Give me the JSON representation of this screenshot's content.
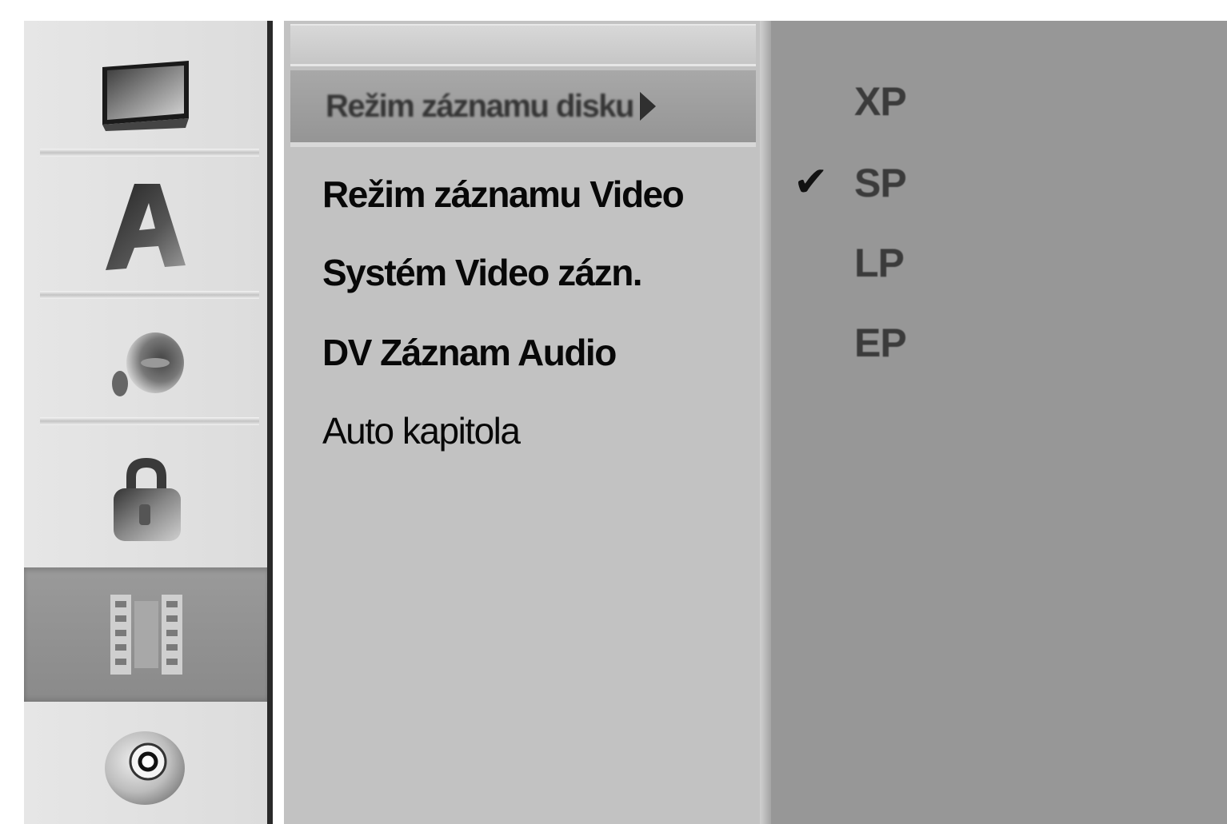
{
  "sidebar": {
    "items": [
      {
        "icon": "tv-screen-icon",
        "selected": false
      },
      {
        "icon": "letter-a-icon",
        "selected": false
      },
      {
        "icon": "audio-speaker-icon",
        "selected": false
      },
      {
        "icon": "lock-icon",
        "selected": false
      },
      {
        "icon": "film-strip-icon",
        "selected": true
      },
      {
        "icon": "disc-icon",
        "selected": false
      }
    ]
  },
  "menu": {
    "highlighted": "Režim záznamu disku",
    "items": [
      {
        "label": "Režim záznamu Video",
        "bold": true
      },
      {
        "label": "Systém Video zázn.",
        "bold": true
      },
      {
        "label": "DV Záznam Audio",
        "bold": true
      },
      {
        "label": "Auto kapitola",
        "bold": false
      }
    ]
  },
  "options": {
    "items": [
      "XP",
      "SP",
      "LP",
      "EP"
    ],
    "selected": "SP",
    "check_mark": "✔"
  },
  "colors": {
    "sidebar_bg": "#e2e2e2",
    "sidebar_selected": "#909090",
    "menu_bg": "#c2c2c2",
    "menu_highlight": "#9e9e9e",
    "options_bg": "#979797"
  }
}
